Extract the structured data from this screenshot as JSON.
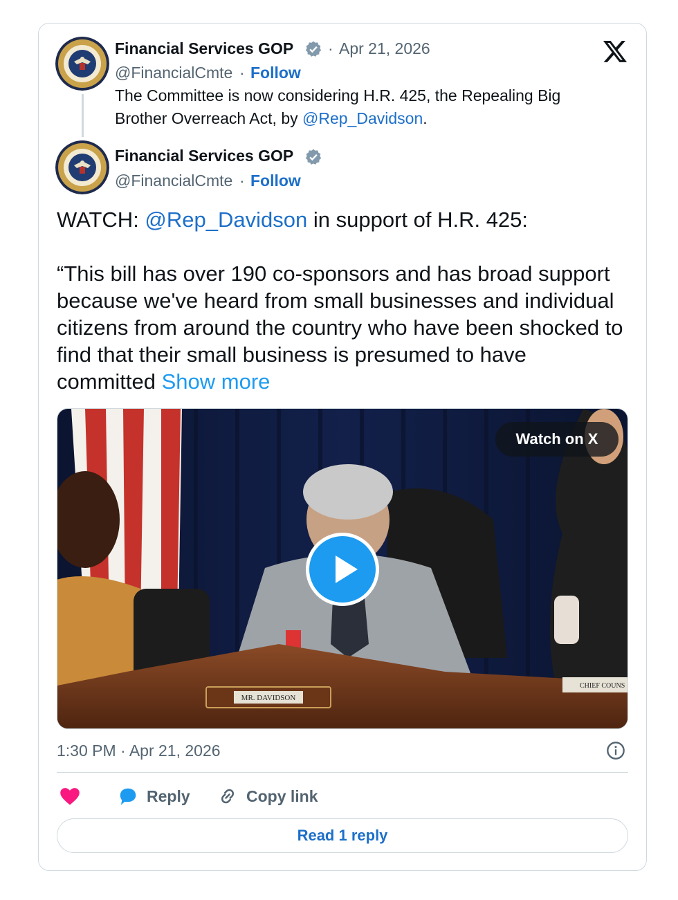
{
  "quoted_tweet": {
    "author_name": "Financial Services GOP",
    "separator_date": "·",
    "date": "Apr 21, 2026",
    "handle": "@FinancialCmte",
    "separator_follow": "·",
    "follow_label": "Follow",
    "text_part1": "The Committee is now considering H.R. 425, the Repealing Big Brother Overreach Act, by ",
    "mention": "@Rep_Davidson",
    "text_part2": "."
  },
  "tweet": {
    "author_name": "Financial Services GOP",
    "handle": "@FinancialCmte",
    "separator_follow": "·",
    "follow_label": "Follow",
    "line1_prefix": "WATCH: ",
    "line1_mention": "@Rep_Davidson",
    "line1_suffix": " in support of H.R. 425:",
    "body": "“This bill has over 190 co-sponsors and has broad support because we've heard from small businesses and individual citizens from around the country who have been shocked to find that their small business is presumed to have committed ",
    "show_more": "Show more",
    "timestamp": "1:30 PM · Apr 21, 2026"
  },
  "media": {
    "watch_label": "Watch on X",
    "nameplate": "MR. DAVIDSON",
    "nameplate_right": "CHIEF COUNS"
  },
  "actions": {
    "reply_label": "Reply",
    "copy_link_label": "Copy link",
    "read_reply_label": "Read 1 reply"
  },
  "icons": {
    "brand": "x-logo-icon",
    "verified": "verified-badge-icon",
    "like": "heart-icon",
    "reply": "reply-bubble-icon",
    "copy": "link-icon",
    "info": "info-icon",
    "play": "play-icon"
  },
  "colors": {
    "link": "#1d6fc9",
    "accent": "#1d9bf0",
    "heart": "#f91880",
    "muted": "#536471",
    "border": "#cfd9de"
  }
}
